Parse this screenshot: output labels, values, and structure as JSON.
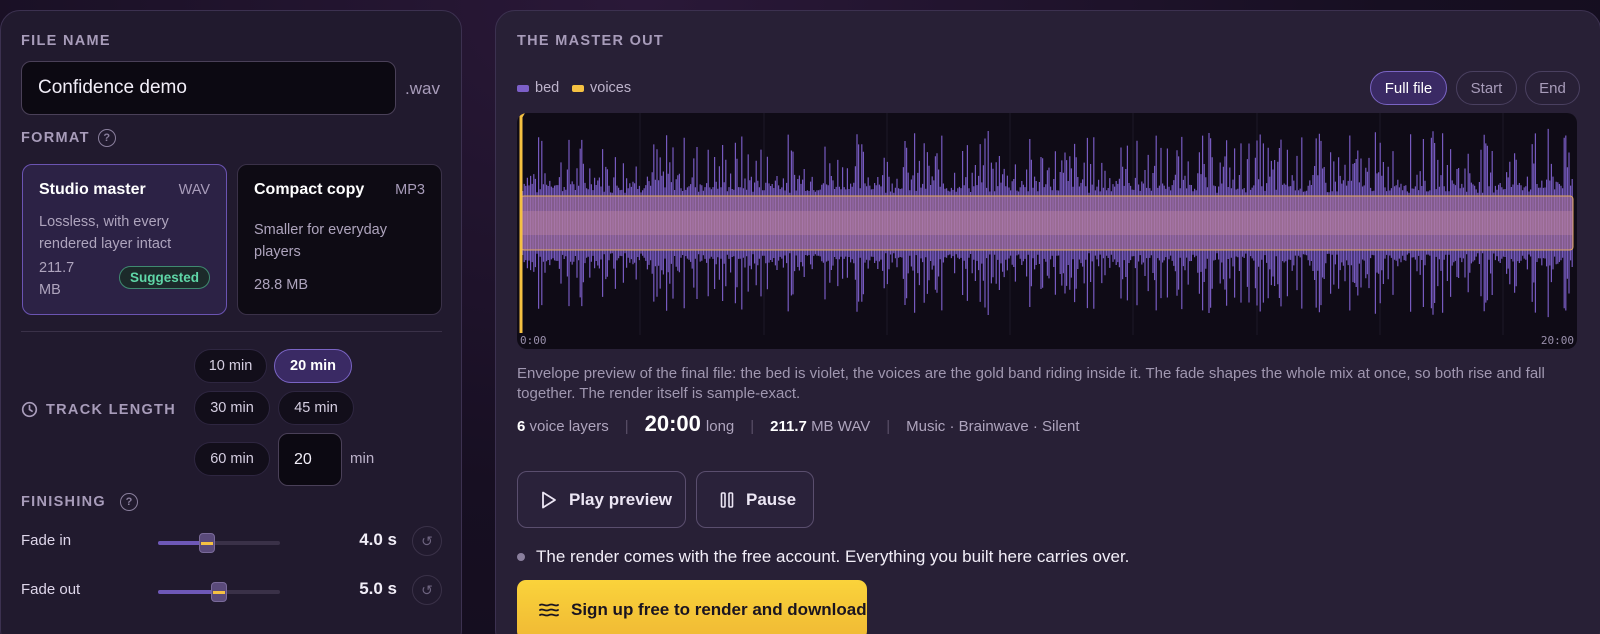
{
  "left": {
    "file_name_label": "FILE NAME",
    "file_name_value": "Confidence demo",
    "file_ext": ".wav",
    "format_label": "FORMAT",
    "help_glyph": "?",
    "formats": [
      {
        "title": "Studio master",
        "kind": "WAV",
        "desc": "Lossless, with every rendered layer intact",
        "size": "211.7 MB",
        "badge": "Suggested",
        "selected": true
      },
      {
        "title": "Compact copy",
        "kind": "MP3",
        "desc": "Smaller for everyday players",
        "size": "28.8 MB",
        "selected": false
      }
    ],
    "track_length_label": "TRACK LENGTH",
    "length_options": [
      "10 min",
      "20 min",
      "30 min",
      "45 min",
      "60 min"
    ],
    "length_selected": "20 min",
    "custom_length_value": "20",
    "custom_length_unit": "min",
    "finishing_label": "FINISHING",
    "fades": [
      {
        "label": "Fade in",
        "value": "4.0 s",
        "level": 0.4
      },
      {
        "label": "Fade out",
        "value": "5.0 s",
        "level": 0.5
      }
    ]
  },
  "right": {
    "title": "THE MASTER OUT",
    "legend": [
      {
        "name": "bed",
        "color": "#7c5fc8"
      },
      {
        "name": "voices",
        "color": "#f5c142"
      }
    ],
    "range_buttons": [
      "Full file",
      "Start",
      "End"
    ],
    "range_selected": "Full file",
    "time_start": "0:00",
    "time_end": "20:00",
    "description": "Envelope preview of the final file: the bed is violet, the voices are the gold band riding inside it. The fade shapes the whole mix at once, so both rise and fall together. The render itself is sample-exact.",
    "stats": {
      "voice_layers_count": "6",
      "voice_layers_text": "voice layers",
      "duration": "20:00",
      "duration_suffix": "long",
      "size_value": "211.7",
      "size_text": "MB WAV",
      "tags": "Music · Brainwave · Silent"
    },
    "play_label": "Play preview",
    "pause_label": "Pause",
    "note": "The render comes with the free account. Everything you built here carries over.",
    "cta_label": "Sign up free to render and download"
  },
  "colors": {
    "accent": "#7a64c4",
    "gold": "#f5c142",
    "success": "#5fd6a7"
  }
}
